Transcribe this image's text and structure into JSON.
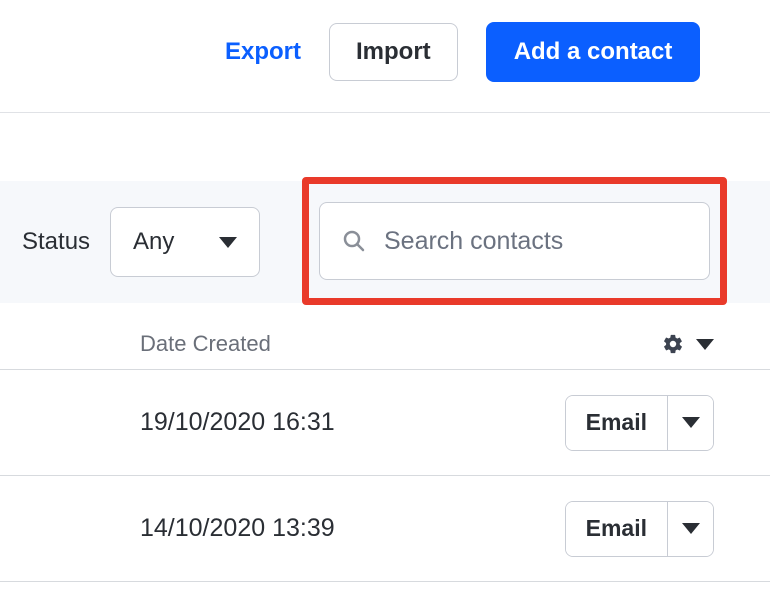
{
  "toolbar": {
    "export_label": "Export",
    "import_label": "Import",
    "add_contact_label": "Add a contact"
  },
  "filter": {
    "status_label": "Status",
    "status_value": "Any",
    "search_placeholder": "Search contacts"
  },
  "table": {
    "date_created_header": "Date Created",
    "rows": [
      {
        "date": "19/10/2020 16:31",
        "action": "Email"
      },
      {
        "date": "14/10/2020 13:39",
        "action": "Email"
      }
    ]
  }
}
